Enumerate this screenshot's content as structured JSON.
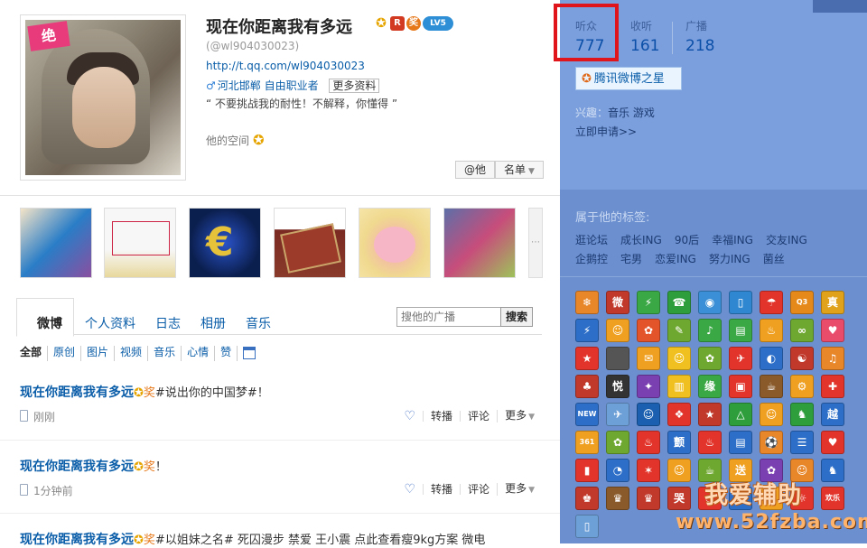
{
  "profile": {
    "name": "现在你距离我有多远",
    "handle": "(@wl904030023)",
    "url": "http://t.qq.com/wl904030023",
    "location": "河北邯郸 自由职业者",
    "more_info": "更多资料",
    "motto": "“ 不要挑战我的耐性！不解释，你懂得 ”",
    "space": "他的空间",
    "badge_labels": [
      "R",
      "奖",
      "LV5"
    ],
    "avatar_badge": "绝",
    "at_button": "@他",
    "list_button": "名单"
  },
  "stats": [
    {
      "label": "听众",
      "value": "777"
    },
    {
      "label": "收听",
      "value": "161"
    },
    {
      "label": "广播",
      "value": "218"
    }
  ],
  "star_button": "腾讯微博之星",
  "interest": {
    "label": "兴趣：",
    "value": "音乐 游戏"
  },
  "apply_link": "立即申请>>",
  "tags": {
    "title": "属于他的标签:",
    "items": [
      "逛论坛",
      "成长ING",
      "90后",
      "幸福ING",
      "交友ING",
      "企鹅控",
      "宅男",
      "恋爱ING",
      "努力ING",
      "菌丝"
    ]
  },
  "tabs": [
    "微博",
    "个人资料",
    "日志",
    "相册",
    "音乐"
  ],
  "search": {
    "placeholder": "搜他的广播",
    "button": "搜索"
  },
  "filters": [
    "全部",
    "原创",
    "图片",
    "视频",
    "音乐",
    "心情",
    "赞"
  ],
  "posts": [
    {
      "author": "现在你距离我有多远",
      "text": "#说出你的中国梦#！",
      "time": "刚刚"
    },
    {
      "author": "现在你距离我有多远",
      "text": "！",
      "time": "1分钟前"
    },
    {
      "author": "现在你距离我有多远",
      "text": "#以姐妹之名# 死囚漫步  禁爱  王小震 点此查看瘦9kg方案 微电",
      "time": ""
    }
  ],
  "post_actions": {
    "repost": "转播",
    "comment": "评论",
    "more": "更多"
  },
  "badge_icons": [
    {
      "color": "#e8862a",
      "text": "❄"
    },
    {
      "color": "#c0392b",
      "text": "微"
    },
    {
      "color": "#3aa845",
      "text": "⚡"
    },
    {
      "color": "#2e9e3c",
      "text": "☎"
    },
    {
      "color": "#3a8fd6",
      "text": "◉"
    },
    {
      "color": "#2f86d1",
      "text": "▯"
    },
    {
      "color": "#e2342a",
      "text": "☂"
    },
    {
      "color": "#e58a1a",
      "text": "Q3"
    },
    {
      "color": "#e0a21a",
      "text": "真"
    },
    {
      "color": "#2d6fc8",
      "text": "⚡"
    },
    {
      "color": "#f0a020",
      "text": "☺"
    },
    {
      "color": "#e4542a",
      "text": "✿"
    },
    {
      "color": "#6fa830",
      "text": "✎"
    },
    {
      "color": "#3aa845",
      "text": "♪"
    },
    {
      "color": "#3aa845",
      "text": "▤"
    },
    {
      "color": "#f0a020",
      "text": "♨"
    },
    {
      "color": "#6fa830",
      "text": "∞"
    },
    {
      "color": "#e94b6b",
      "text": "♥"
    },
    {
      "color": "#e2342a",
      "text": "★"
    },
    {
      "color": "#555555",
      "text": ""
    },
    {
      "color": "#f0a020",
      "text": "✉"
    },
    {
      "color": "#f0c020",
      "text": "☺"
    },
    {
      "color": "#6fa830",
      "text": "✿"
    },
    {
      "color": "#e2342a",
      "text": "✈"
    },
    {
      "color": "#2d6fc8",
      "text": "◐"
    },
    {
      "color": "#c0392b",
      "text": "☯"
    },
    {
      "color": "#e8862a",
      "text": "♫"
    },
    {
      "color": "#c0392b",
      "text": "♣"
    },
    {
      "color": "#333333",
      "text": "悦"
    },
    {
      "color": "#7a3fb0",
      "text": "✦"
    },
    {
      "color": "#f0c020",
      "text": "▥"
    },
    {
      "color": "#3aa845",
      "text": "缘"
    },
    {
      "color": "#e2342a",
      "text": "▣"
    },
    {
      "color": "#8a5a2a",
      "text": "☕"
    },
    {
      "color": "#f0a020",
      "text": "⚙"
    },
    {
      "color": "#e2342a",
      "text": "✚"
    },
    {
      "color": "#2d6fc8",
      "text": "NEW"
    },
    {
      "color": "#6ea0d8",
      "text": "✈"
    },
    {
      "color": "#1a5fb0",
      "text": "☺"
    },
    {
      "color": "#e2342a",
      "text": "❖"
    },
    {
      "color": "#c0392b",
      "text": "★"
    },
    {
      "color": "#2e9e3c",
      "text": "△"
    },
    {
      "color": "#f0a020",
      "text": "☺"
    },
    {
      "color": "#2e9e3c",
      "text": "♞"
    },
    {
      "color": "#2d6fc8",
      "text": "越"
    },
    {
      "color": "#f0a020",
      "text": "361"
    },
    {
      "color": "#6fa830",
      "text": "✿"
    },
    {
      "color": "#e2342a",
      "text": "♨"
    },
    {
      "color": "#2d6fc8",
      "text": "颤"
    },
    {
      "color": "#e2342a",
      "text": "♨"
    },
    {
      "color": "#2d6fc8",
      "text": "▤"
    },
    {
      "color": "#e8862a",
      "text": "⚽"
    },
    {
      "color": "#2d6fc8",
      "text": "☰"
    },
    {
      "color": "#e2342a",
      "text": "♥"
    },
    {
      "color": "#e2342a",
      "text": "▮"
    },
    {
      "color": "#2d6fc8",
      "text": "◔"
    },
    {
      "color": "#e2342a",
      "text": "✶"
    },
    {
      "color": "#f0a020",
      "text": "☺"
    },
    {
      "color": "#6fa830",
      "text": "☕"
    },
    {
      "color": "#f0a020",
      "text": "送"
    },
    {
      "color": "#7a3fb0",
      "text": "✿"
    },
    {
      "color": "#e8862a",
      "text": "☺"
    },
    {
      "color": "#2d6fc8",
      "text": "♞"
    },
    {
      "color": "#c0392b",
      "text": "♚"
    },
    {
      "color": "#8a5a2a",
      "text": "♛"
    },
    {
      "color": "#c0392b",
      "text": "♛"
    },
    {
      "color": "#c0392b",
      "text": "哭"
    },
    {
      "color": "#e2342a",
      "text": "♨"
    },
    {
      "color": "#2d6fc8",
      "text": "☻"
    },
    {
      "color": "#f0a020",
      "text": "☺"
    },
    {
      "color": "#e2342a",
      "text": "☼"
    },
    {
      "color": "#e2342a",
      "text": "欢乐"
    },
    {
      "color": "#6ea0d8",
      "text": "▯"
    }
  ],
  "watermark": {
    "line1": "我爱辅助",
    "line2": "www.52fzba.com"
  }
}
